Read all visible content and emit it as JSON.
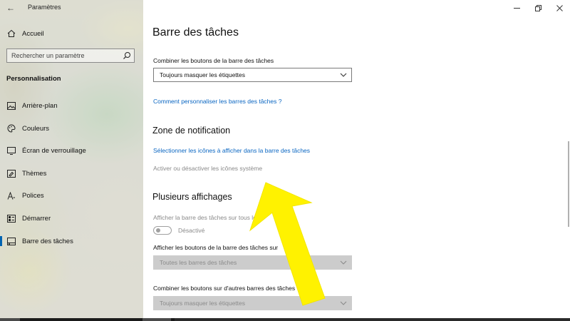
{
  "window": {
    "app_title": "Paramètres"
  },
  "sidebar": {
    "home_label": "Accueil",
    "search_placeholder": "Rechercher un paramètre",
    "section_heading": "Personnalisation",
    "items": [
      {
        "label": "Arrière-plan",
        "icon": "picture-icon"
      },
      {
        "label": "Couleurs",
        "icon": "palette-icon"
      },
      {
        "label": "Écran de verrouillage",
        "icon": "lock-screen-icon"
      },
      {
        "label": "Thèmes",
        "icon": "brush-icon"
      },
      {
        "label": "Polices",
        "icon": "font-icon"
      },
      {
        "label": "Démarrer",
        "icon": "start-icon"
      },
      {
        "label": "Barre des tâches",
        "icon": "taskbar-icon",
        "active": true
      }
    ]
  },
  "content": {
    "title": "Barre des tâches",
    "combine_label": "Combiner les boutons de la barre des tâches",
    "combine_value": "Toujours masquer les étiquettes",
    "customize_link": "Comment personnaliser les barres des tâches ?",
    "notification": {
      "title": "Zone de notification",
      "select_icons_link": "Sélectionner les icônes à afficher dans la barre des tâches",
      "system_icons_link": "Activer ou désactiver les icônes système"
    },
    "multi_display": {
      "title": "Plusieurs affichages",
      "show_all_label": "Afficher la barre des tâches sur tous les",
      "toggle_state": "Désactivé",
      "show_buttons_label": "Afficher les boutons de la barre des tâches sur",
      "show_buttons_value": "Toutes les barres des tâches",
      "combine_other_label": "Combiner les boutons sur d'autres barres des tâches",
      "combine_other_value": "Toujours masquer les étiquettes"
    }
  },
  "colors": {
    "accent": "#0063b1",
    "link": "#0a66c2",
    "annotation_arrow": "#fff200"
  }
}
